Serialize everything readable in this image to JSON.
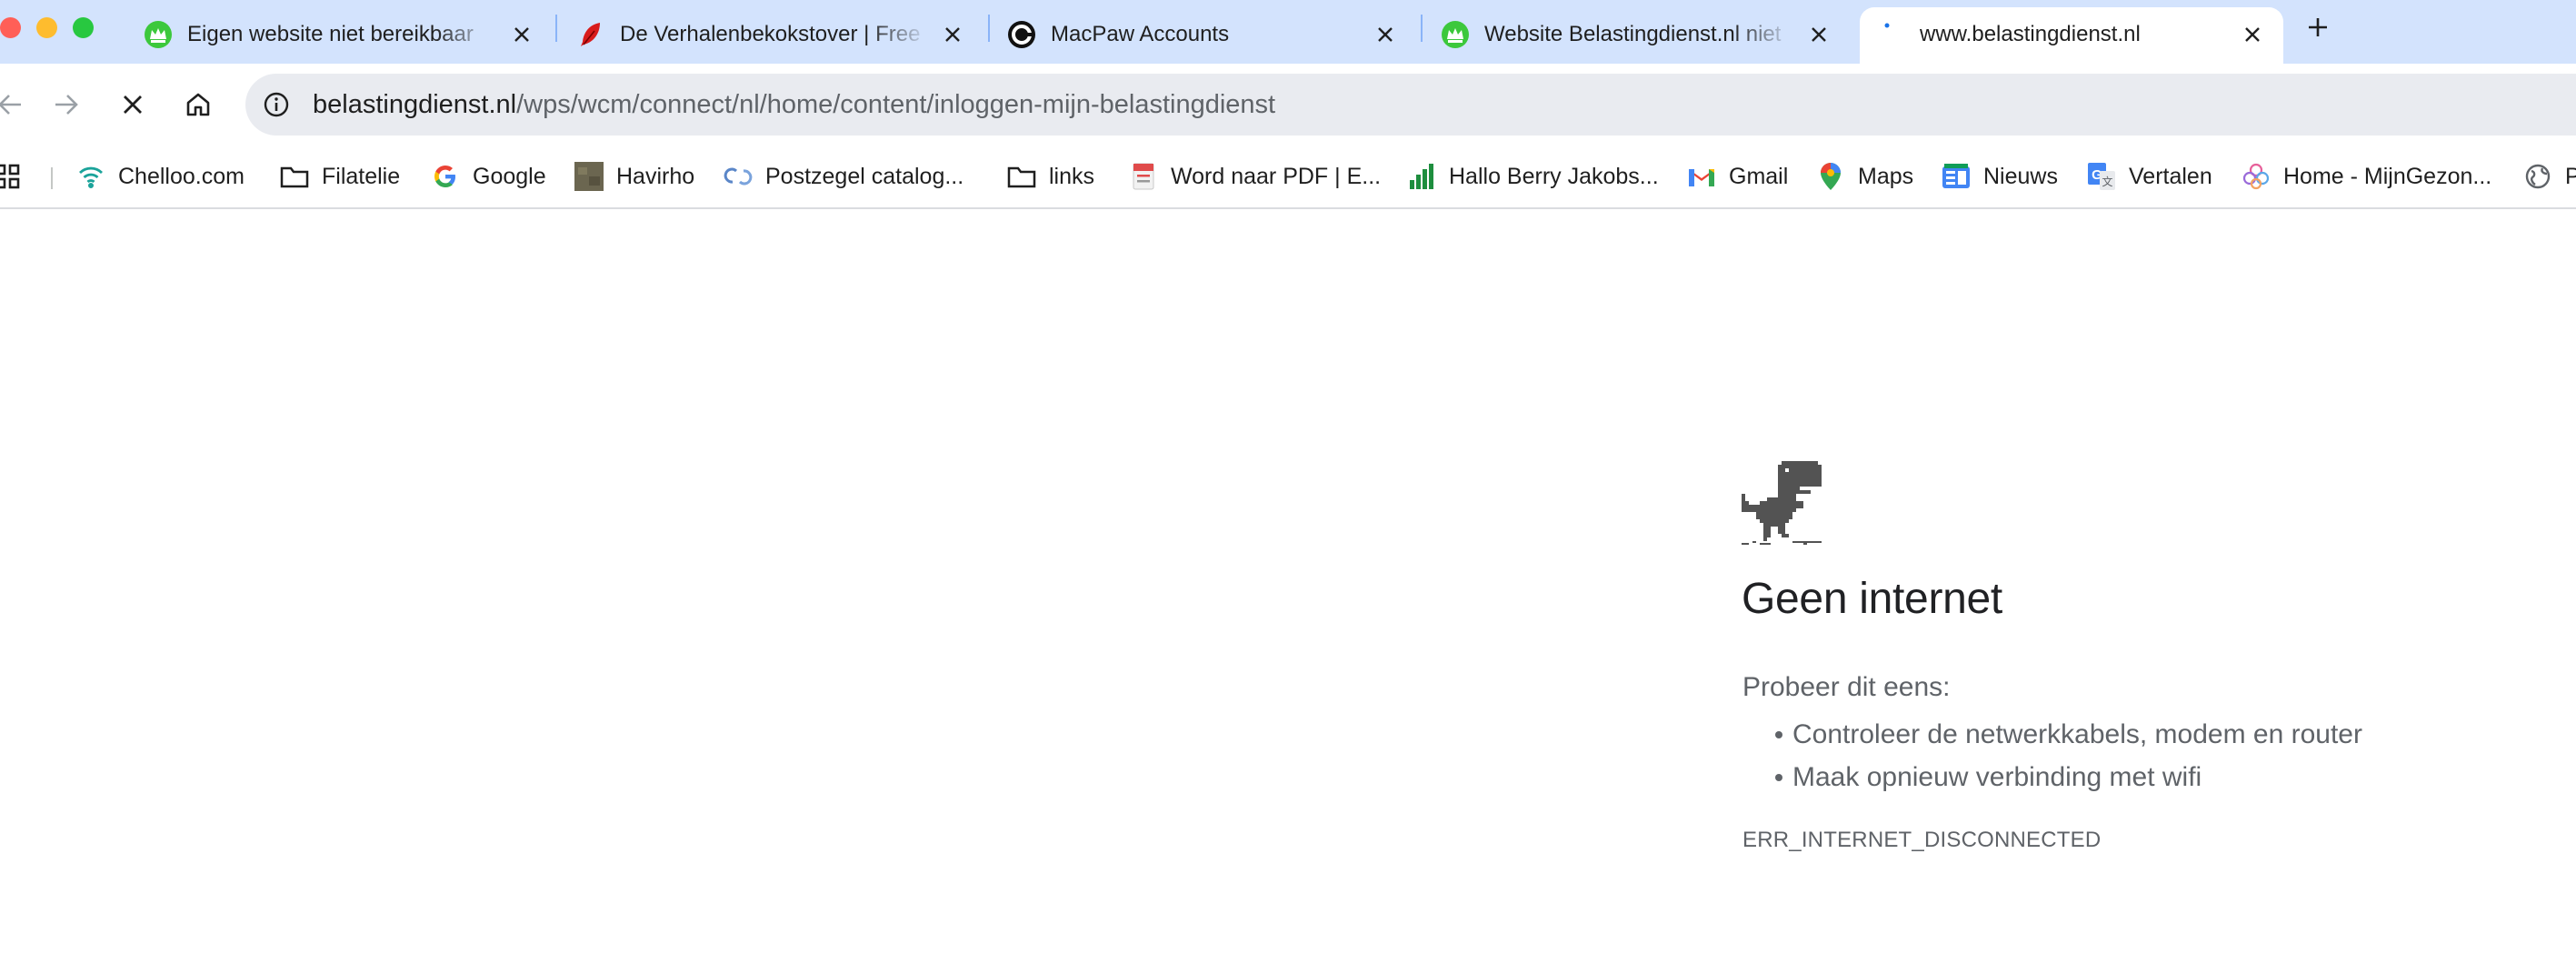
{
  "window": {
    "traffic_lights": [
      "close",
      "minimize",
      "zoom"
    ]
  },
  "tabs": [
    {
      "title": "Eigen website niet bereikbaar",
      "favicon": "crown-icon",
      "active": false
    },
    {
      "title": "De Verhalenbekokstover | Free",
      "favicon": "feather-icon",
      "active": false
    },
    {
      "title": "MacPaw Accounts",
      "favicon": "macpaw-icon",
      "active": false
    },
    {
      "title": "Website Belastingdienst.nl niet",
      "favicon": "crown-icon",
      "active": false
    },
    {
      "title": "www.belastingdienst.nl",
      "favicon": "loading-icon",
      "active": true
    }
  ],
  "toolbar": {
    "url_host": "belastingdienst.nl",
    "url_path": "/wps/wcm/connect/nl/home/content/inloggen-mijn-belastingdienst"
  },
  "bookmarks": [
    {
      "label": "Chelloo.com",
      "icon": "wifi-icon"
    },
    {
      "label": "Filatelie",
      "icon": "folder-icon"
    },
    {
      "label": "Google",
      "icon": "google-icon"
    },
    {
      "label": "Havirho",
      "icon": "image-icon"
    },
    {
      "label": "Postzegel catalog...",
      "icon": "link-icon"
    },
    {
      "label": "links",
      "icon": "folder-icon"
    },
    {
      "label": "Word naar PDF | E...",
      "icon": "pdf-icon"
    },
    {
      "label": "Hallo Berry Jakobs...",
      "icon": "bars-icon"
    },
    {
      "label": "Gmail",
      "icon": "gmail-icon"
    },
    {
      "label": "Maps",
      "icon": "maps-icon"
    },
    {
      "label": "Nieuws",
      "icon": "news-icon"
    },
    {
      "label": "Vertalen",
      "icon": "translate-icon"
    },
    {
      "label": "Home - MijnGezon...",
      "icon": "flower-icon"
    },
    {
      "label": "P",
      "icon": "globe-icon"
    }
  ],
  "error_page": {
    "title": "Geen internet",
    "try_text": "Probeer dit eens:",
    "suggestions": [
      "Controleer de netwerkkabels, modem en router",
      "Maak opnieuw verbinding met wifi"
    ],
    "error_code": "ERR_INTERNET_DISCONNECTED"
  },
  "colors": {
    "tabstrip": "#d3e3fd",
    "omnibox": "#e9ebf0",
    "text": "#1f1f1f",
    "muted": "#5f6368"
  }
}
